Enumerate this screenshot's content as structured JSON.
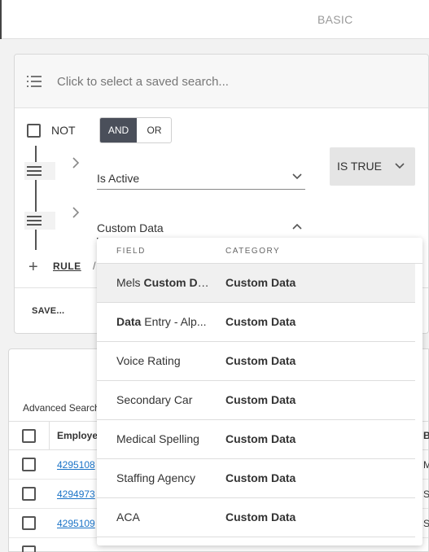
{
  "header": {
    "mode_label": "BASIC"
  },
  "query": {
    "saved_search_placeholder": "Click to select a saved search...",
    "not_label": "NOT",
    "and_label": "AND",
    "or_label": "OR",
    "rules": [
      {
        "field": "Is Active",
        "operator": "IS TRUE"
      },
      {
        "field": "Custom Data"
      }
    ],
    "add_rule_label": "RULE",
    "separator": "/",
    "save_label": "SAVE..."
  },
  "results": {
    "advanced_label": "Advanced Search",
    "columns": [
      "Employe",
      "B"
    ],
    "rows": [
      {
        "id": "4295108",
        "c2": "M"
      },
      {
        "id": "4294973",
        "c2": "S"
      },
      {
        "id": "4295109",
        "c2": "S"
      }
    ]
  },
  "dropdown": {
    "header_field": "FIELD",
    "header_category": "CATEGORY",
    "items": [
      {
        "field_pre": "Mels ",
        "field_bold": "Custom Da...",
        "field_post": "",
        "category": "Custom Data"
      },
      {
        "field_pre": "",
        "field_bold": "Data",
        "field_post": " Entry - Alp...",
        "category": "Custom Data"
      },
      {
        "field_pre": "Voice Rating",
        "field_bold": "",
        "field_post": "",
        "category": "Custom Data"
      },
      {
        "field_pre": "Secondary Car",
        "field_bold": "",
        "field_post": "",
        "category": "Custom Data"
      },
      {
        "field_pre": "Medical Spelling",
        "field_bold": "",
        "field_post": "",
        "category": "Custom Data"
      },
      {
        "field_pre": "Staffing Agency",
        "field_bold": "",
        "field_post": "",
        "category": "Custom Data"
      },
      {
        "field_pre": "ACA",
        "field_bold": "",
        "field_post": "",
        "category": "Custom Data"
      }
    ]
  }
}
